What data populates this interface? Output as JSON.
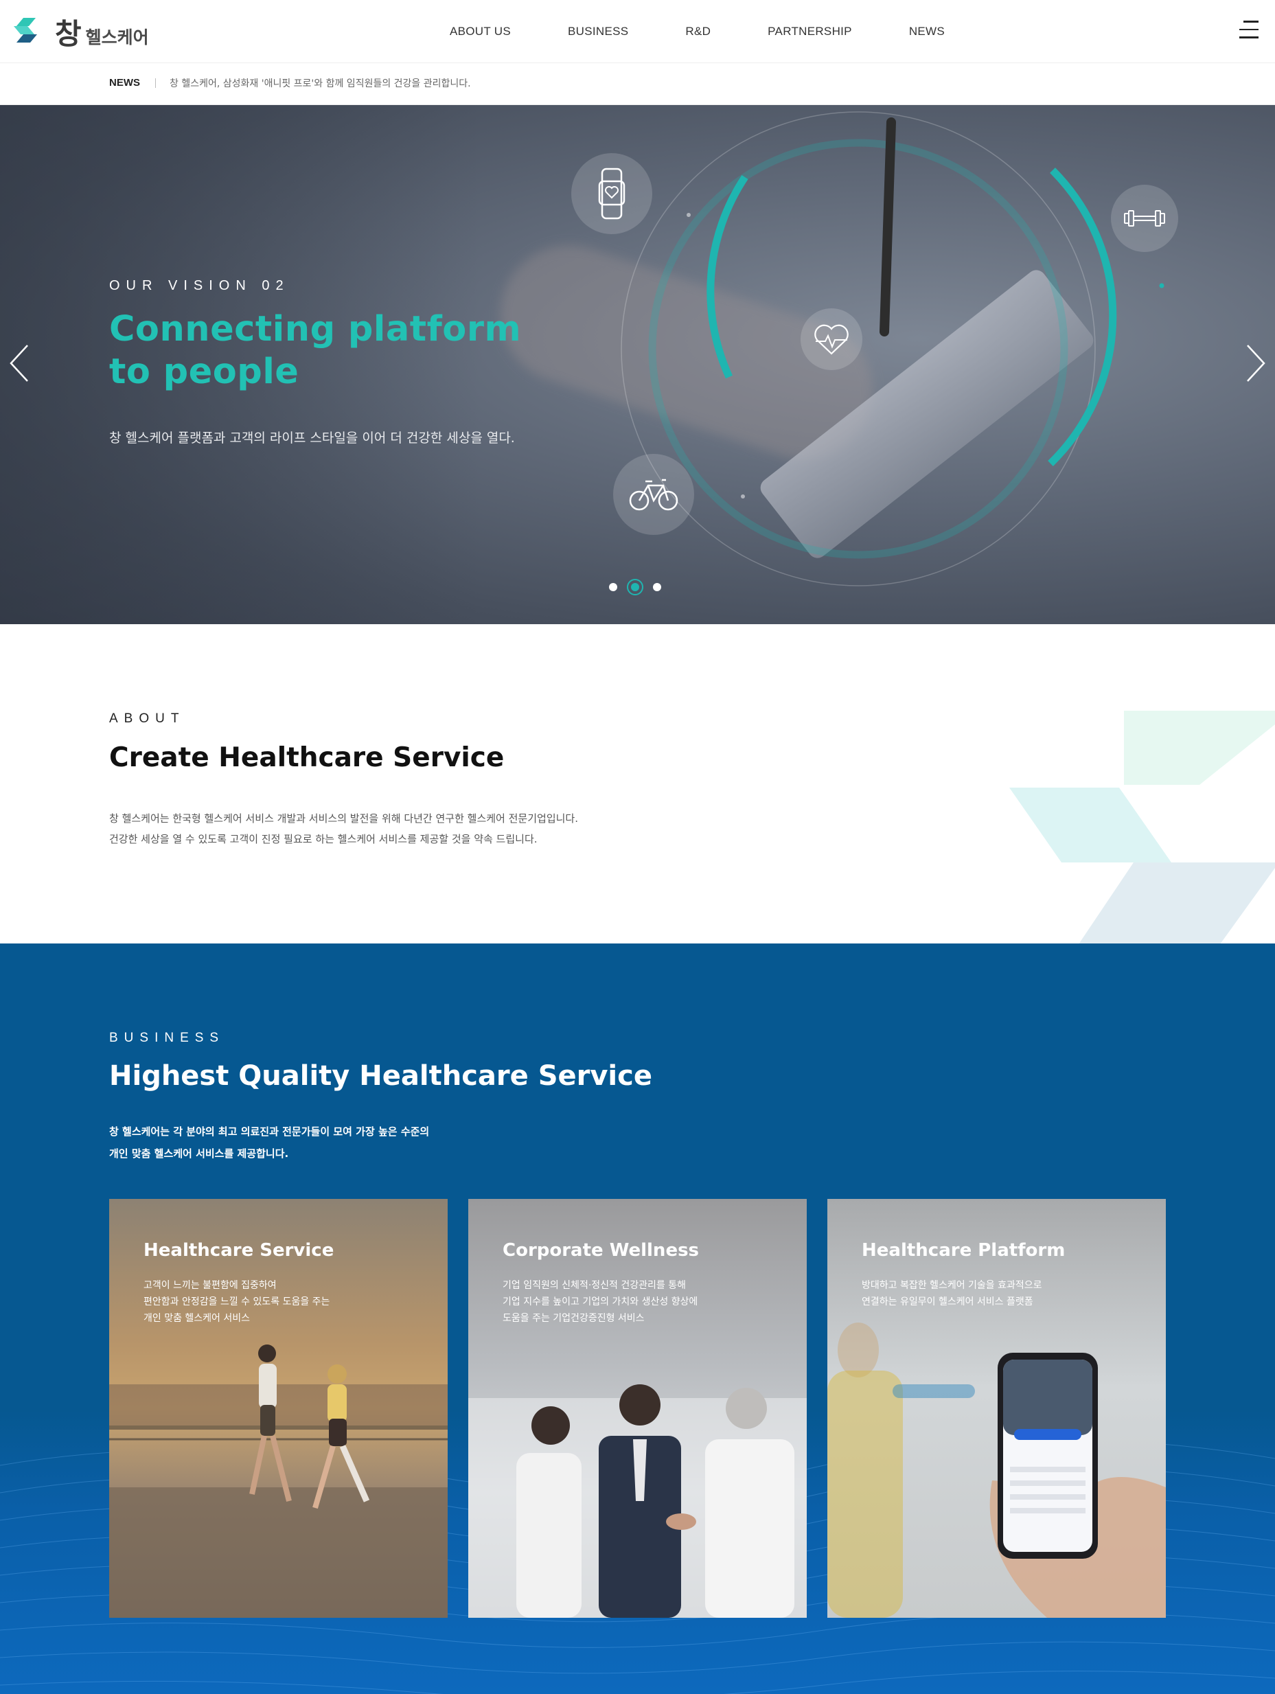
{
  "header": {
    "logo_big": "창",
    "logo_small": "헬스케어",
    "nav": [
      "ABOUT US",
      "BUSINESS",
      "R&D",
      "PARTNERSHIP",
      "NEWS"
    ]
  },
  "newsbar": {
    "label": "NEWS",
    "headline": "창 헬스케어, 삼성화재 '애니핏 프로'와 함께 임직원들의 건강을 관리합니다."
  },
  "hero": {
    "eyebrow": "OUR VISION 02",
    "title_line1": "Connecting platform",
    "title_line2": "to people",
    "subtitle": "창 헬스케어 플랫폼과 고객의 라이프 스타일을 이어 더 건강한 세상을 열다.",
    "slides_total": 3,
    "active_slide": 2,
    "accent_color": "#1fb5b0"
  },
  "about": {
    "eyebrow": "ABOUT",
    "title": "Create Healthcare Service",
    "desc_line1": "창 헬스케어는 한국형 헬스케어 서비스 개발과 서비스의 발전을 위해 다년간 연구한 헬스케어 전문기업입니다.",
    "desc_line2": "건강한 세상을 열 수 있도록 고객이 진정 필요로 하는 헬스케어 서비스를 제공할 것을 약속 드립니다."
  },
  "business": {
    "eyebrow": "BUSINESS",
    "title": "Highest Quality Healthcare Service",
    "desc_line1": "창 헬스케어는 각 분야의 최고 의료진과 전문가들이 모여 가장 높은 수준의",
    "desc_line2": "개인 맞춤 헬스케어 서비스를 제공합니다.",
    "background_color": "#065891",
    "cards": [
      {
        "title": "Healthcare Service",
        "lines": [
          "고객이 느끼는 불편함에 집중하여",
          "편안함과 안정감을 느낄 수 있도록 도움을 주는",
          "개인 맞춤 헬스케어 서비스"
        ]
      },
      {
        "title": "Corporate Wellness",
        "lines": [
          "기업 임직원의 신체적·정신적 건강관리를 통해",
          "기업 지수를 높이고 기업의 가치와 생산성 향상에",
          "도움을 주는 기업건강증진형 서비스"
        ]
      },
      {
        "title": "Healthcare Platform",
        "lines": [
          "방대하고 복잡한 헬스케어 기술을 효과적으로",
          "연결하는 유일무이 헬스케어 서비스 플랫폼"
        ]
      }
    ]
  }
}
